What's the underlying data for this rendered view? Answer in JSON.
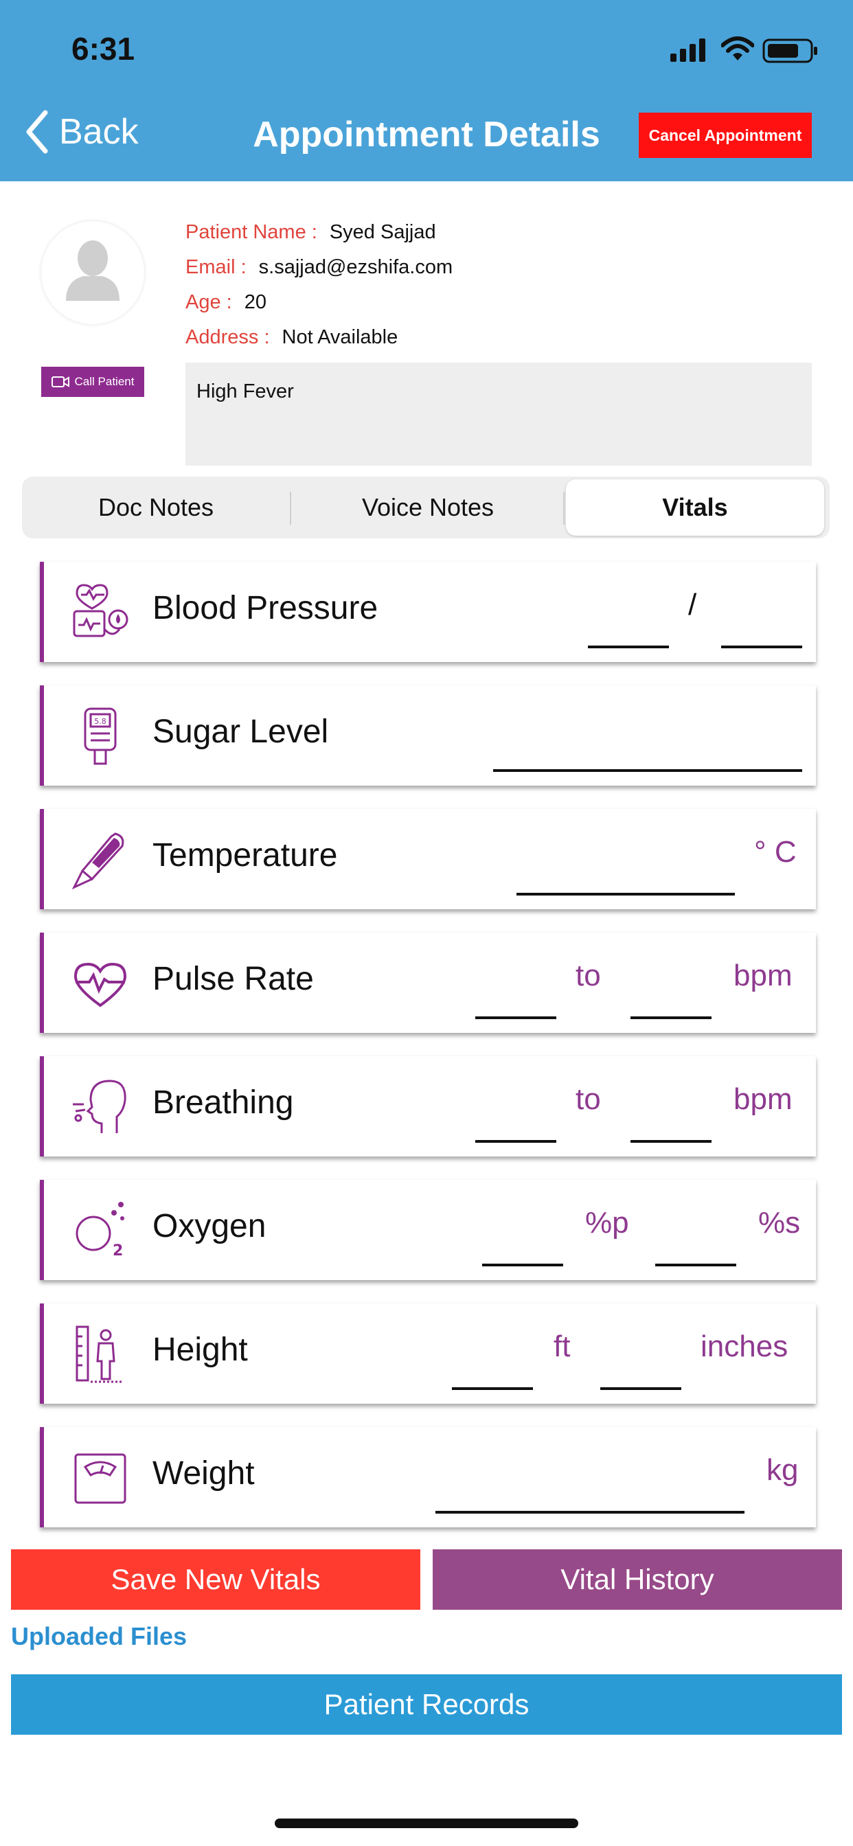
{
  "status_bar": {
    "time": "6:31"
  },
  "header": {
    "back_label": "Back",
    "title": "Appointment Details",
    "cancel_label": "Cancel Appointment"
  },
  "patient": {
    "call_label": "Call Patient",
    "name_key": "Patient Name :",
    "name": "Syed Sajjad",
    "email_key": "Email :",
    "email": "s.sajjad@ezshifa.com",
    "age_key": "Age :",
    "age": "20",
    "address_key": "Address :",
    "address": "Not Available",
    "complaint": "High Fever"
  },
  "tabs": {
    "doc_notes": "Doc Notes",
    "voice_notes": "Voice Notes",
    "vitals": "Vitals",
    "selected": "Vitals"
  },
  "vitals": {
    "blood_pressure": {
      "label": "Blood Pressure",
      "separator": "/"
    },
    "sugar_level": {
      "label": "Sugar Level"
    },
    "temperature": {
      "label": "Temperature",
      "unit": "° C"
    },
    "pulse_rate": {
      "label": "Pulse Rate",
      "mid": "to",
      "unit": "bpm"
    },
    "breathing": {
      "label": "Breathing",
      "mid": "to",
      "unit": "bpm"
    },
    "oxygen": {
      "label": "Oxygen",
      "mid": "%p",
      "unit": "%s"
    },
    "height": {
      "label": "Height",
      "mid": "ft",
      "unit": "inches"
    },
    "weight": {
      "label": "Weight",
      "unit": "kg"
    }
  },
  "actions": {
    "save_label": "Save New Vitals",
    "history_label": "Vital History",
    "uploaded_files": "Uploaded Files",
    "patient_records": "Patient Records"
  },
  "colors": {
    "header": "#4aa3d8",
    "accent_purple": "#8e2b8f",
    "cancel_red": "#ff1111",
    "save_red": "#ff3b30",
    "records_blue": "#2b9bd6"
  }
}
